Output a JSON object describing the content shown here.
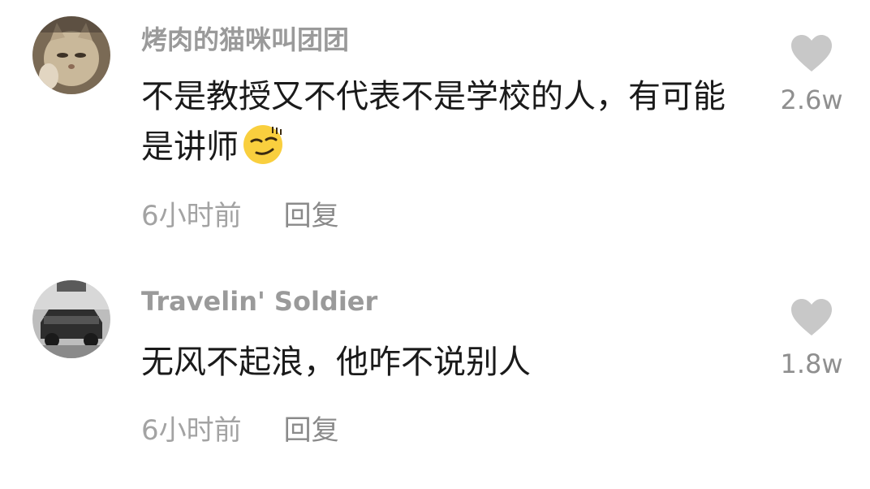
{
  "comments": [
    {
      "username": "烤肉的猫咪叫团团",
      "text": "不是教授又不代表不是学校的人，有可能是讲师",
      "emoji": "smirk-emoji",
      "time": "6小时前",
      "reply_label": "回复",
      "like_count": "2.6w"
    },
    {
      "username": "Travelin' Soldier",
      "text": "无风不起浪，他咋不说别人",
      "time": "6小时前",
      "reply_label": "回复",
      "like_count": "1.8w"
    }
  ],
  "colors": {
    "username": "#9a9a9a",
    "text": "#1a1a1a",
    "meta": "#a3a3a3",
    "heart": "#c8c8c8"
  }
}
